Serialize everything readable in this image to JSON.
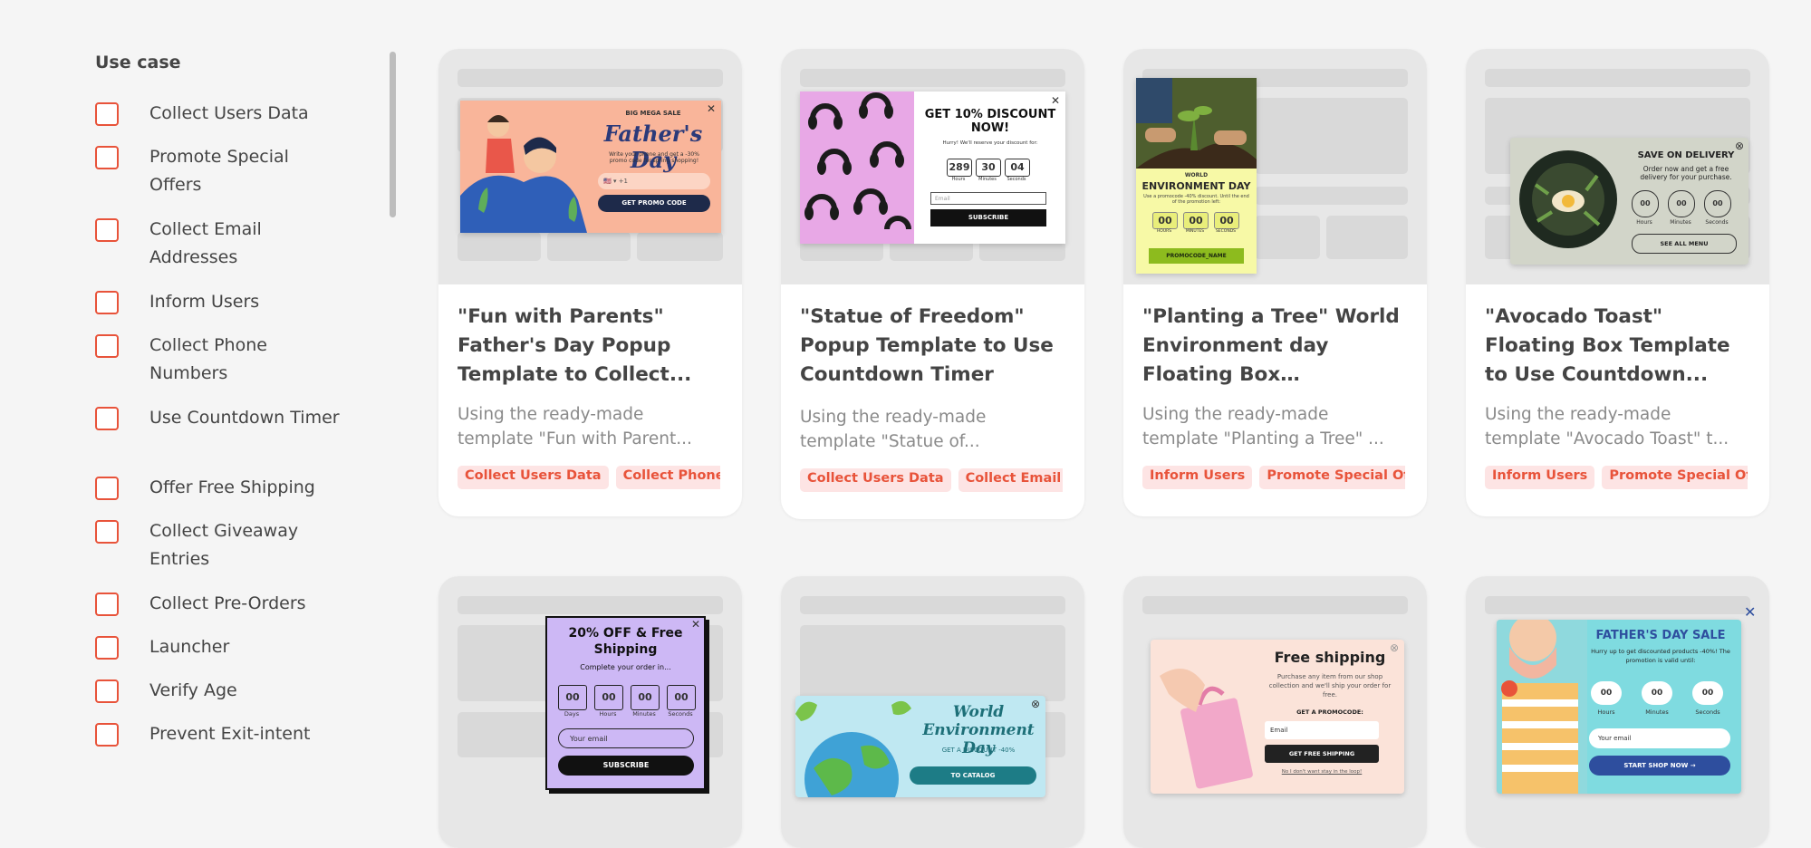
{
  "sidebar": {
    "title": "Use case",
    "filters": [
      {
        "label": "Collect Users Data"
      },
      {
        "label": "Promote Special Offers"
      },
      {
        "label": "Collect Email Addresses"
      },
      {
        "label": "Inform Users"
      },
      {
        "label": "Collect Phone Numbers"
      },
      {
        "label": "Use Countdown Timer"
      },
      {
        "label": "Offer Free Shipping"
      },
      {
        "label": "Collect Giveaway Entries"
      },
      {
        "label": "Collect Pre-Orders"
      },
      {
        "label": "Launcher"
      },
      {
        "label": "Verify Age"
      },
      {
        "label": "Prevent Exit-intent"
      }
    ]
  },
  "colors": {
    "accent": "#e8533a",
    "tag_bg": "#fde4e4"
  },
  "cards": [
    {
      "title": "\"Fun with Parents\" Father's Day Popup Template to Collect...",
      "description": "Using the ready-made template \"Fun with Parent...",
      "tags": [
        "Collect Users Data",
        "Collect Phone N"
      ],
      "popup": {
        "kicker": "BIG MEGA SALE",
        "heading": "Father's Day",
        "text": "Write your phone and get a -30% promo code for spring shopping!",
        "phone": "+1",
        "button": "GET PROMO CODE"
      }
    },
    {
      "title": "\"Statue of Freedom\" Popup Template to Use Countdown Timer",
      "description": "Using the ready-made template \"Statue of...",
      "tags": [
        "Collect Users Data",
        "Collect Email Ac"
      ],
      "popup": {
        "heading": "GET 10% DISCOUNT NOW!",
        "text": "Hurry! We'll reserve your discount for:",
        "timer": [
          "289",
          "30",
          "04"
        ],
        "timer_labels": [
          "Hours",
          "Minutes",
          "Seconds"
        ],
        "placeholder": "Email",
        "button": "SUBSCRIBE"
      }
    },
    {
      "title": "\"Planting a Tree\" World Environment day Floating Box Template...",
      "description": "Using the ready-made template \"Planting a Tree\" ...",
      "tags": [
        "Inform Users",
        "Promote Special Offe"
      ],
      "popup": {
        "kicker": "WORLD",
        "heading": "ENVIRONMENT DAY",
        "text": "Use a promocode -40% discount. Until the end of the promotion left:",
        "timer": [
          "00",
          "00",
          "00"
        ],
        "timer_labels": [
          "HOURS",
          "MINUTES",
          "SECONDS"
        ],
        "button": "PROMOCODE_NAME"
      }
    },
    {
      "title": "\"Avocado Toast\" Floating Box Template to Use Countdown...",
      "description": "Using the ready-made template \"Avocado Toast\" t...",
      "tags": [
        "Inform Users",
        "Promote Special Offe"
      ],
      "popup": {
        "heading": "SAVE ON DELIVERY",
        "text": "Order now and get a free delivery for your purchase.",
        "timer": [
          "00",
          "00",
          "00"
        ],
        "timer_labels": [
          "Hours",
          "Minutes",
          "Seconds"
        ],
        "button": "SEE ALL MENU"
      }
    },
    {
      "popup": {
        "heading": "20% OFF & Free Shipping",
        "text": "Complete your order in...",
        "timer": [
          "00",
          "00",
          "00",
          "00"
        ],
        "timer_labels": [
          "Days",
          "Hours",
          "Minutes",
          "Seconds"
        ],
        "placeholder": "Your email",
        "button": "SUBSCRIBE"
      }
    },
    {
      "popup": {
        "heading": "World Environment Day",
        "text": "GET A DISCOUNT -40%",
        "button": "TO CATALOG"
      }
    },
    {
      "popup": {
        "heading": "Free shipping",
        "text": "Purchase any item from our shop collection and we'll ship your order for free.",
        "subtext": "GET A PROMOCODE:",
        "placeholder": "Email",
        "button": "GET FREE SHIPPING",
        "link": "No I don't want stay in the loop!"
      }
    },
    {
      "popup": {
        "heading": "FATHER'S DAY SALE",
        "text": "Hurry up to get discounted products -40%! The promotion is valid until:",
        "timer": [
          "00",
          "00",
          "00"
        ],
        "timer_labels": [
          "Hours",
          "Minutes",
          "Seconds"
        ],
        "placeholder": "Your email",
        "button": "START SHOP NOW →"
      }
    }
  ]
}
